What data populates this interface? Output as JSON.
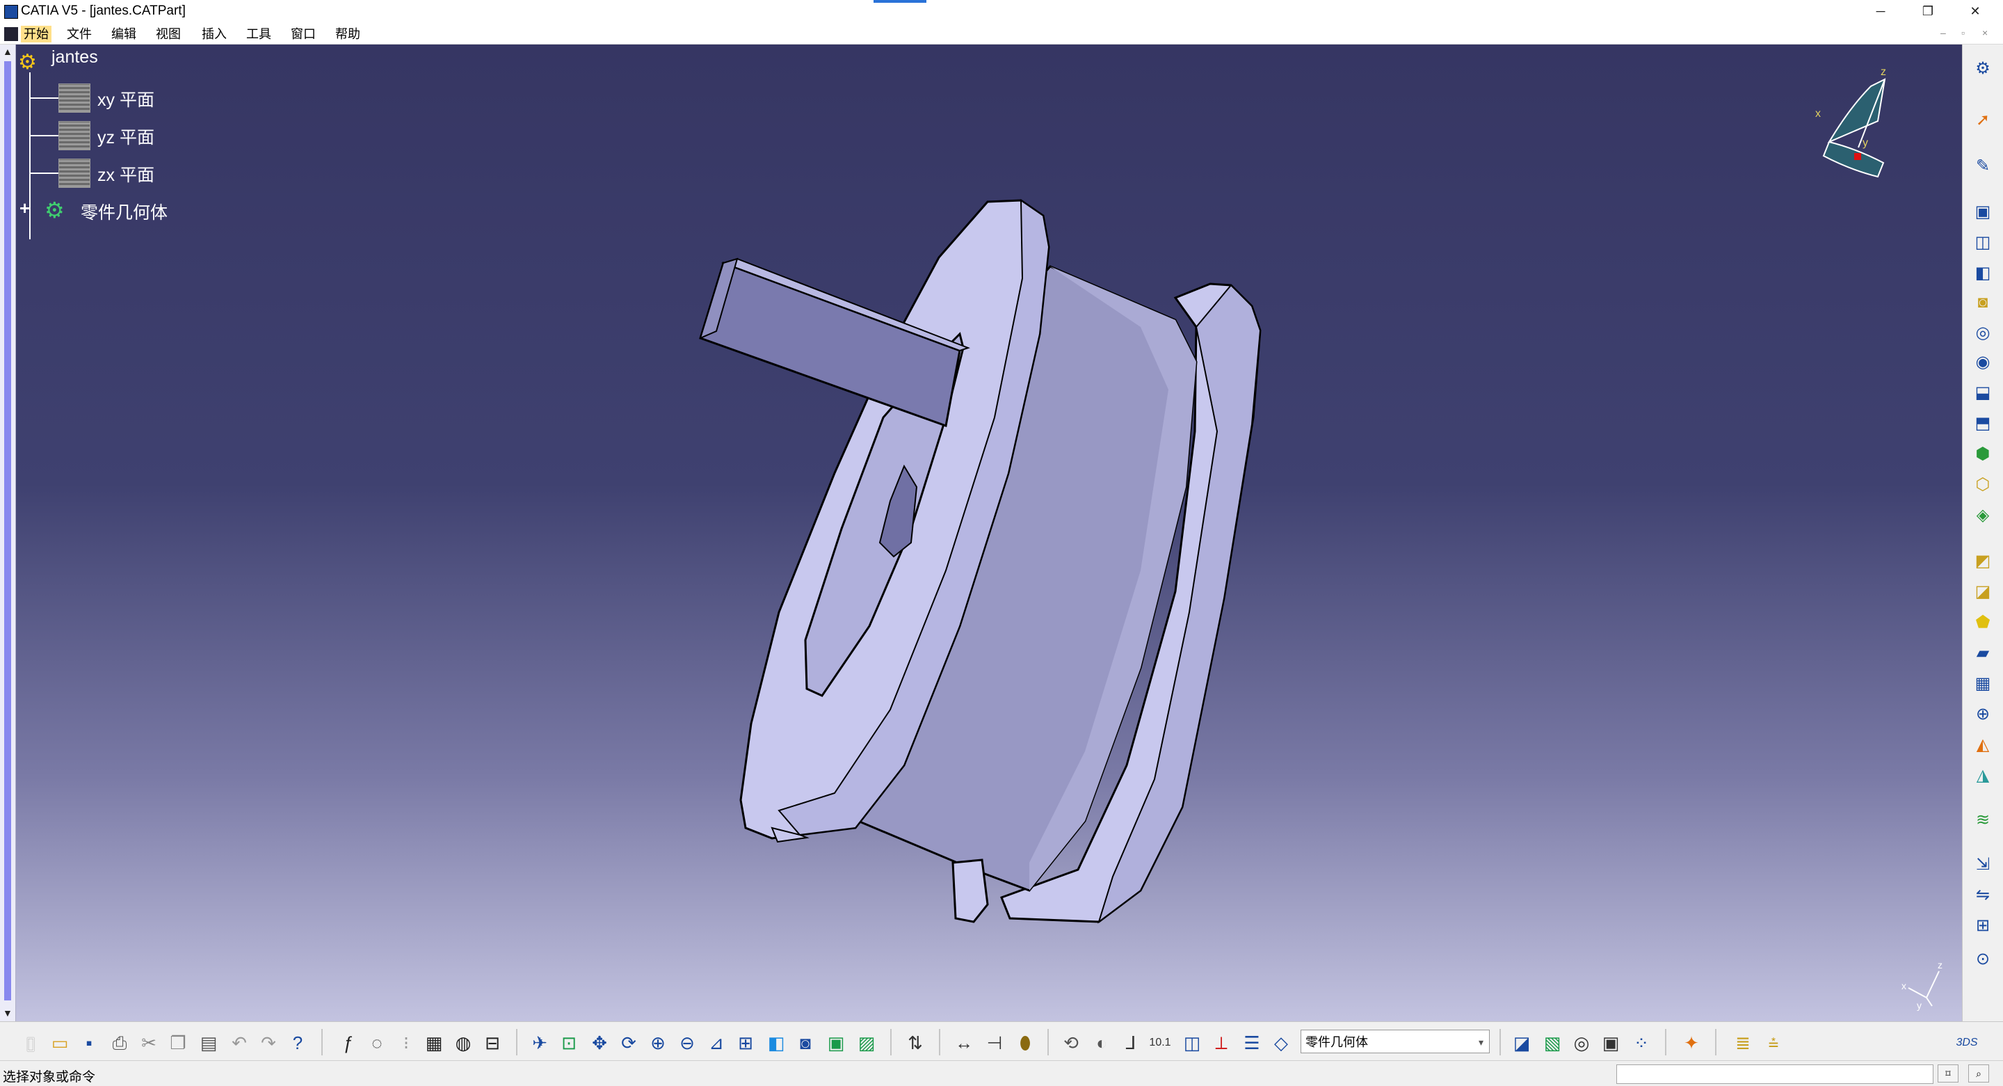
{
  "window": {
    "title": "CATIA V5 - [jantes.CATPart]",
    "minimize": "─",
    "restore": "❐",
    "close": "✕"
  },
  "menu": {
    "items": [
      "开始",
      "文件",
      "编辑",
      "视图",
      "插入",
      "工具",
      "窗口",
      "帮助"
    ]
  },
  "tree": {
    "root": "jantes",
    "planes": [
      "xy 平面",
      "yz 平面",
      "zx 平面"
    ],
    "body": "零件几何体"
  },
  "compass": {
    "x": "x",
    "y": "y",
    "z": "z"
  },
  "toolbar": {
    "current_body": "零件几何体"
  },
  "status": {
    "message": "选择对象或命令",
    "command_value": ""
  },
  "colors": {
    "accent": "#1a4aa0",
    "viewport_top": "#363663",
    "viewport_bottom": "#c3c3e0",
    "part_face": "#c8c8ee",
    "part_shade": "#9898c4"
  }
}
